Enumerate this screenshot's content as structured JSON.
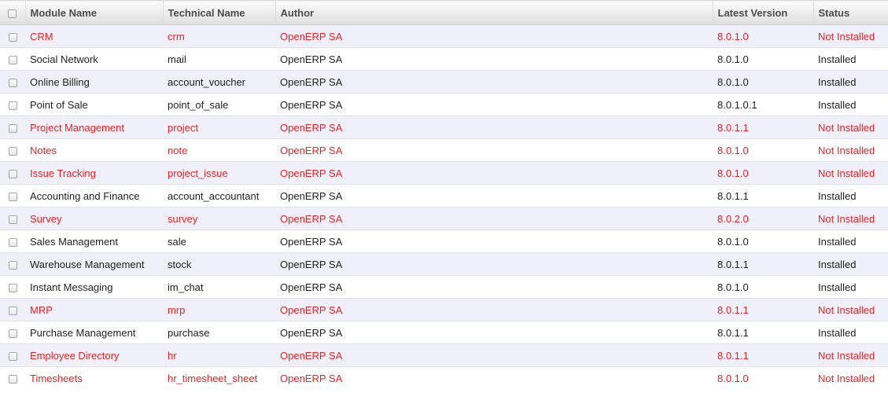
{
  "table": {
    "columns": [
      "Module Name",
      "Technical Name",
      "Author",
      "Latest Version",
      "Status"
    ],
    "rows": [
      {
        "name": "CRM",
        "technical": "crm",
        "author": "OpenERP SA",
        "version": "8.0.1.0",
        "status": "Not Installed"
      },
      {
        "name": "Social Network",
        "technical": "mail",
        "author": "OpenERP SA",
        "version": "8.0.1.0",
        "status": "Installed"
      },
      {
        "name": "Online Billing",
        "technical": "account_voucher",
        "author": "OpenERP SA",
        "version": "8.0.1.0",
        "status": "Installed"
      },
      {
        "name": "Point of Sale",
        "technical": "point_of_sale",
        "author": "OpenERP SA",
        "version": "8.0.1.0.1",
        "status": "Installed"
      },
      {
        "name": "Project Management",
        "technical": "project",
        "author": "OpenERP SA",
        "version": "8.0.1.1",
        "status": "Not Installed"
      },
      {
        "name": "Notes",
        "technical": "note",
        "author": "OpenERP SA",
        "version": "8.0.1.0",
        "status": "Not Installed"
      },
      {
        "name": "Issue Tracking",
        "technical": "project_issue",
        "author": "OpenERP SA",
        "version": "8.0.1.0",
        "status": "Not Installed"
      },
      {
        "name": "Accounting and Finance",
        "technical": "account_accountant",
        "author": "OpenERP SA",
        "version": "8.0.1.1",
        "status": "Installed"
      },
      {
        "name": "Survey",
        "technical": "survey",
        "author": "OpenERP SA",
        "version": "8.0.2.0",
        "status": "Not Installed"
      },
      {
        "name": "Sales Management",
        "technical": "sale",
        "author": "OpenERP SA",
        "version": "8.0.1.0",
        "status": "Installed"
      },
      {
        "name": "Warehouse Management",
        "technical": "stock",
        "author": "OpenERP SA",
        "version": "8.0.1.1",
        "status": "Installed"
      },
      {
        "name": "Instant Messaging",
        "technical": "im_chat",
        "author": "OpenERP SA",
        "version": "8.0.1.0",
        "status": "Installed"
      },
      {
        "name": "MRP",
        "technical": "mrp",
        "author": "OpenERP SA",
        "version": "8.0.1.1",
        "status": "Not Installed"
      },
      {
        "name": "Purchase Management",
        "technical": "purchase",
        "author": "OpenERP SA",
        "version": "8.0.1.1",
        "status": "Installed"
      },
      {
        "name": "Employee Directory",
        "technical": "hr",
        "author": "OpenERP SA",
        "version": "8.0.1.1",
        "status": "Not Installed"
      },
      {
        "name": "Timesheets",
        "technical": "hr_timesheet_sheet",
        "author": "OpenERP SA",
        "version": "8.0.1.0",
        "status": "Not Installed"
      }
    ]
  },
  "colors": {
    "not_installed_text": "#ee1f1f",
    "odd_row_bg": "#f0f0fa",
    "header_text": "#4c4c4c"
  }
}
